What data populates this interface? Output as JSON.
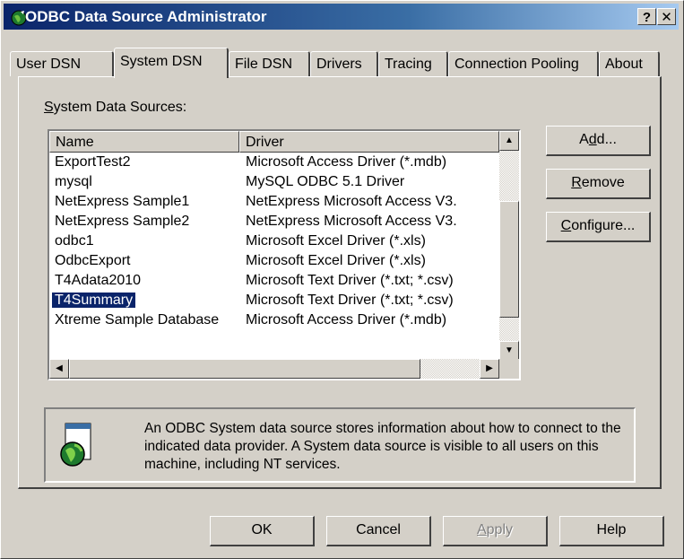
{
  "window": {
    "title": "ODBC Data Source Administrator",
    "help_button": "?",
    "close_button": "✕"
  },
  "tabs": [
    {
      "label": "User DSN"
    },
    {
      "label": "System DSN"
    },
    {
      "label": "File DSN"
    },
    {
      "label": "Drivers"
    },
    {
      "label": "Tracing"
    },
    {
      "label": "Connection Pooling"
    },
    {
      "label": "About"
    }
  ],
  "active_tab": "System DSN",
  "system_dsn": {
    "group_label_mnemonic": "S",
    "group_label_rest": "ystem Data Sources:",
    "columns": {
      "name": "Name",
      "driver": "Driver"
    },
    "rows": [
      {
        "name": "ExportTest2",
        "driver": "Microsoft Access Driver (*.mdb)"
      },
      {
        "name": "mysql",
        "driver": "MySQL ODBC 5.1 Driver"
      },
      {
        "name": "NetExpress Sample1",
        "driver": "NetExpress Microsoft Access V3."
      },
      {
        "name": "NetExpress Sample2",
        "driver": "NetExpress Microsoft Access V3."
      },
      {
        "name": "odbc1",
        "driver": "Microsoft Excel Driver (*.xls)"
      },
      {
        "name": "OdbcExport",
        "driver": "Microsoft Excel Driver (*.xls)"
      },
      {
        "name": "T4Adata2010",
        "driver": "Microsoft Text Driver (*.txt; *.csv)"
      },
      {
        "name": "T4Summary",
        "driver": "Microsoft Text Driver (*.txt; *.csv)"
      },
      {
        "name": "Xtreme Sample Database",
        "driver": "Microsoft Access Driver (*.mdb)"
      }
    ],
    "selected_row": "T4Summary",
    "buttons": {
      "add_pre": "A",
      "add_mn": "d",
      "add_post": "d...",
      "remove_mn": "R",
      "remove_post": "emove",
      "configure_mn": "C",
      "configure_post": "onfigure..."
    },
    "info_text": "An ODBC System data source stores information about how to connect to the indicated data provider.  A System data source is visible to all users on this machine, including NT services."
  },
  "dialog_buttons": {
    "ok": "OK",
    "cancel": "Cancel",
    "apply_mn": "A",
    "apply_post": "pply",
    "help": "Help"
  },
  "icons": {
    "title": "globe-window-icon",
    "info": "globe-document-icon"
  },
  "colors": {
    "title_bar": "#0a246a",
    "selection": "#0a246a",
    "face": "#d4d0c8"
  }
}
